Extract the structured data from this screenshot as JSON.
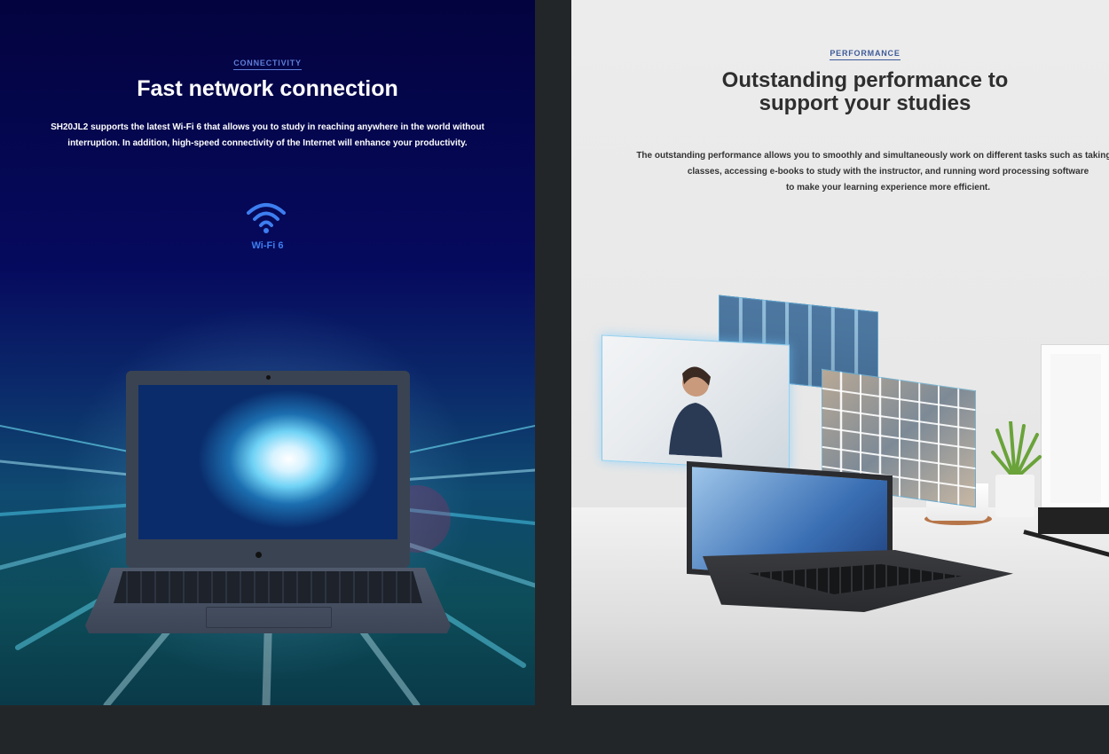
{
  "connectivity": {
    "eyebrow": "CONNECTIVITY",
    "title": "Fast network connection",
    "description": "SH20JL2 supports the latest Wi-Fi 6 that allows you to study in reaching anywhere in the world without interruption. In addition, high-speed connectivity of the Internet will enhance your productivity.",
    "feature_icon": "wifi-icon",
    "feature_label": "Wi-Fi 6"
  },
  "performance": {
    "eyebrow": "PERFORMANCE",
    "title_line1": "Outstanding performance to",
    "title_line2": "support your studies",
    "description_line1": "The outstanding performance allows you to smoothly and simultaneously work on different tasks such as taking online",
    "description_line2": "classes, accessing e-books to study with the instructor, and running word processing software",
    "description_line3": "to make your learning experience more efficient."
  },
  "colors": {
    "accent_blue": "#3d7ef0",
    "left_background": "#03033f",
    "right_background": "#ececec",
    "page_background": "#232629"
  }
}
